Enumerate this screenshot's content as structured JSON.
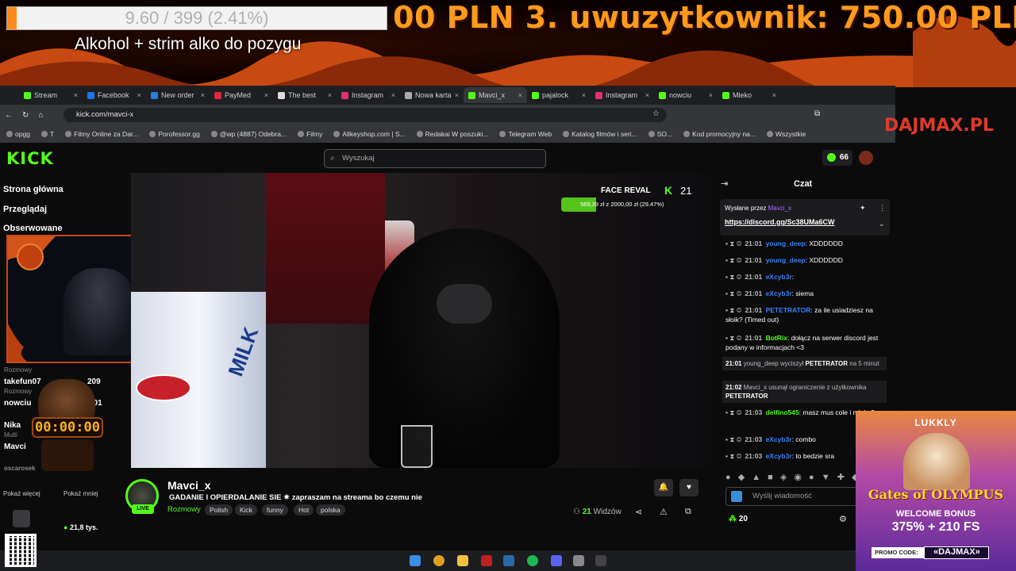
{
  "overlay": {
    "goal_text": "9.60 / 399 (2.41%)",
    "goal_progress": 0.0241,
    "goal_title": "Alkohol + strim alko do pozygu",
    "ticker": "00 PLN    3. uwuzytkownik: 750.00 PLN",
    "brand": "DAJMAX.PL"
  },
  "browser": {
    "tabs": [
      {
        "label": "Stream",
        "color": "#53fc18"
      },
      {
        "label": "Facebook",
        "color": "#1877f2"
      },
      {
        "label": "New order",
        "color": "#2a7de1"
      },
      {
        "label": "PayMed",
        "color": "#e0263c"
      },
      {
        "label": "The best",
        "color": "#dddddd"
      },
      {
        "label": "Instagram",
        "color": "#e1306c"
      },
      {
        "label": "Nowa karta",
        "color": "#aaaaaa"
      },
      {
        "label": "Mavci_x",
        "color": "#53fc18"
      },
      {
        "label": "pajalock",
        "color": "#53fc18"
      },
      {
        "label": "Instagram",
        "color": "#e1306c"
      },
      {
        "label": "nowciu",
        "color": "#53fc18"
      },
      {
        "label": "Mleko",
        "color": "#53fc18"
      }
    ],
    "url": "kick.com/mavci-x",
    "bookmarks": [
      "opgg",
      "T",
      "Filmy Online za Dar...",
      "Porofessor.gg",
      "@wp (4887) Odebra...",
      "Filmy",
      "Allkeyshop.com | S...",
      "Redakai W poszuki...",
      "Telegram Web",
      "Katalog filmów i seri...",
      "SO...",
      "Kod promocyjny na...",
      "Wszystkie"
    ]
  },
  "kick": {
    "logo": "KICK",
    "search_placeholder": "Wyszukaj",
    "points": "66"
  },
  "sidebar": {
    "nav": [
      "Strona główna",
      "Przeglądaj",
      "Obserwowane"
    ],
    "recommended": [
      {
        "category": "Rozmowy",
        "name": "takefun07",
        "viewers": "209"
      },
      {
        "category": "Rozmowy",
        "name": "nowciu",
        "viewers": "201"
      },
      {
        "category": "Multi",
        "name": "Nika",
        "viewers": ""
      },
      {
        "category": "",
        "name": "Mavci",
        "viewers": ""
      },
      {
        "category": "",
        "name": "oscarosek",
        "viewers": ""
      }
    ],
    "show_more": "Pokaż więcej",
    "show_less": "Pokaż mniej",
    "followers": "21,8 tys."
  },
  "timer": "00:00:00",
  "video": {
    "goal_label": "FACE REVAL",
    "goal_count": "21",
    "goal_progress_text": "589,39 zł z 2000,00 zł (29.47%)",
    "goal_progress": 0.2947,
    "milk_brand": "MILK"
  },
  "channel": {
    "name": "Mavci_x",
    "live": "LIVE",
    "title": "GADANIE I OPIERDALANIE SIE ✷ zapraszam na streama bo czemu nie",
    "category": "Rozmowy",
    "tags": [
      "Polish",
      "Kick",
      "funny",
      "Hot",
      "polska"
    ],
    "viewers": "21",
    "viewers_label": "Widzów"
  },
  "chat": {
    "title": "Czat",
    "pinned_by_label": "Wysłane przez",
    "pinned_user": "Mavci_x",
    "pinned_link": "https://discord.gg/Sc38UMa6CW",
    "messages": [
      {
        "time": "21:01",
        "user": "young_deep",
        "user_color": "#3b82f6",
        "text": "XDDDDDD"
      },
      {
        "time": "21:01",
        "user": "young_deep",
        "user_color": "#3b82f6",
        "text": "XDDDDDD"
      },
      {
        "time": "21:01",
        "user": "eXcyb3r",
        "user_color": "#3b82f6",
        "text": ""
      },
      {
        "time": "21:01",
        "user": "eXcyb3r",
        "user_color": "#3b82f6",
        "text": "siema"
      },
      {
        "time": "21:01",
        "user": "PETETRATOR",
        "user_color": "#3b82f6",
        "text": "za ile usiadziesz na słoik? (Timed out)"
      },
      {
        "time": "21:01",
        "user": "BotRix",
        "user_color": "#53fc18",
        "text": "dołącz na serwer discord jest podany w informacjach <3"
      },
      {
        "time": "21:03",
        "user": "delfino545",
        "user_color": "#53fc18",
        "text": "masz mus cole i mleko?"
      },
      {
        "time": "21:03",
        "user": "eXcyb3r",
        "user_color": "#3b82f6",
        "text": "combo"
      },
      {
        "time": "21:03",
        "user": "eXcyb3r",
        "user_color": "#3b82f6",
        "text": "to bedzie sra"
      }
    ],
    "system": [
      {
        "time": "21:01",
        "text_a": "young_deep wyciszył",
        "target": "PETETRATOR",
        "text_b": "na 5 minut"
      },
      {
        "time": "21:02",
        "text_a": "Mavci_x usunął ograniczenie z użytkownika",
        "target": "PETETRATOR",
        "text_b": ""
      }
    ],
    "input_placeholder": "Wyślij wiadomość",
    "points": "20"
  },
  "ad": {
    "brand": "LUKKLY",
    "game": "Gates of OLYMPUS",
    "welcome": "WELCOME BONUS",
    "bonus": "375% + 210 FS",
    "promo_label": "PROMO CODE:",
    "promo_code": "«DAJMAX»"
  }
}
